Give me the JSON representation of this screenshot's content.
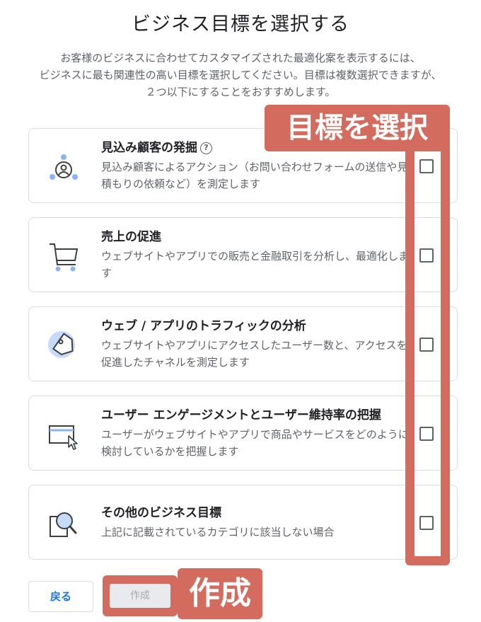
{
  "header": {
    "title": "ビジネス目標を選択する",
    "description": [
      "お客様のビジネスに合わせてカスタマイズされた最適化案を表示するには、",
      "ビジネスに最も関連性の高い目標を選択してください。目標は複数選択できますが、",
      "２つ以下にすることをおすすめします。"
    ]
  },
  "objectives": [
    {
      "title": "見込み顧客の発掘",
      "help": "?",
      "description": "見込み顧客によるアクション（お問い合わせフォームの送信や見積もりの依頼など）を測定します",
      "icon": "lead-person-icon",
      "checked": false
    },
    {
      "title": "売上の促進",
      "description": "ウェブサイトやアプリでの販売と金融取引を分析し、最適化します",
      "icon": "shopping-cart-icon",
      "checked": false
    },
    {
      "title": "ウェブ / アプリのトラフィックの分析",
      "description": "ウェブサイトやアプリにアクセスしたユーザー数と、アクセスを促進したチャネルを測定します",
      "icon": "tag-icon",
      "checked": false
    },
    {
      "title": "ユーザー エンゲージメントとユーザー維持率の把握",
      "description": "ユーザーがウェブサイトやアプリで商品やサービスをどのように検討しているかを把握します",
      "icon": "browser-cursor-icon",
      "checked": false
    },
    {
      "title": "その他のビジネス目標",
      "description": "上記に記載されているカテゴリに該当しない場合",
      "icon": "magnifier-icon",
      "checked": false
    }
  ],
  "annotations": {
    "select_goal": "目標を選択",
    "create": "作成",
    "color": "#d36c5e"
  },
  "footer": {
    "back_label": "戻る",
    "create_label": "作成"
  },
  "colors": {
    "accent_blue": "#1a73e8",
    "icon_blue": "#8ab4f8",
    "text_primary": "#202124",
    "text_secondary": "#5f6368"
  }
}
